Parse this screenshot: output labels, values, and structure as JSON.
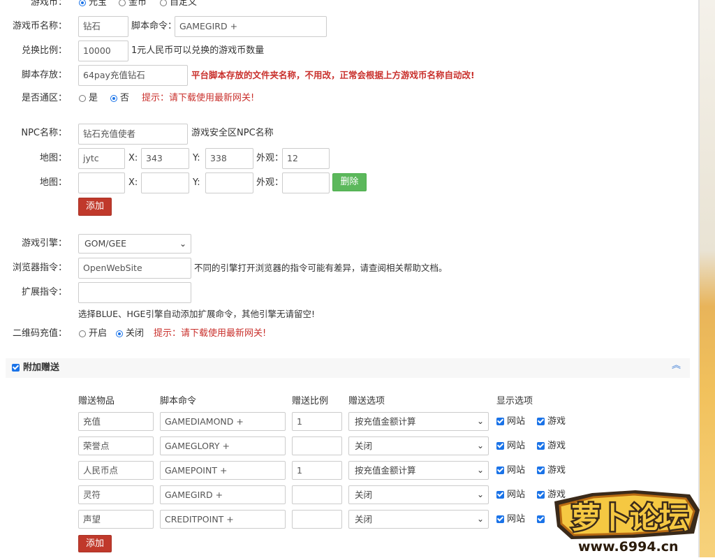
{
  "currency": {
    "label": "游戏币：",
    "options": [
      "元宝",
      "金币",
      "自定义"
    ],
    "selected": "元宝",
    "name_label": "游戏币名称：",
    "name_value": "钻石",
    "script_label": "脚本命令：",
    "script_value": "GAMEGIRD +",
    "ratio_label": "兑换比例：",
    "ratio_value": "10000",
    "ratio_hint": "1元人民币可以兑换的游戏币数量",
    "folder_label": "脚本存放：",
    "folder_value": "64pay充值钻石",
    "folder_hint": "平台脚本存放的文件夹名称，不用改，正常会根据上方游戏币名称自动改!",
    "allzone_label": "是否通区：",
    "allzone_options": [
      "是",
      "否"
    ],
    "allzone_selected": "否",
    "allzone_tip": "提示：请下载使用最新网关!"
  },
  "npc": {
    "label": "NPC名称：",
    "value": "钻石充值使者",
    "hint": "游戏安全区NPC名称",
    "map_label": "地图：",
    "x_label": "X:",
    "y_label": "Y:",
    "look_label": "外观：",
    "rows": [
      {
        "map": "jytc",
        "x": "343",
        "y": "338",
        "look": "12"
      },
      {
        "map": "",
        "x": "",
        "y": "",
        "look": ""
      }
    ],
    "delete_label": "删除",
    "add_label": "添加"
  },
  "engine": {
    "label": "游戏引擎：",
    "value": "GOM/GEE",
    "browser_label": "浏览器指令：",
    "browser_value": "OpenWebSite",
    "browser_hint": "不同的引擎打开浏览器的指令可能有差异，请查阅相关帮助文档。",
    "ext_label": "扩展指令：",
    "ext_value": "",
    "ext_hint": "选择BLUE、HGE引擎自动添加扩展命令，其他引擎无请留空!",
    "qr_label": "二维码充值：",
    "qr_options": [
      "开启",
      "关闭"
    ],
    "qr_selected": "关闭",
    "qr_tip": "提示：请下载使用最新网关!"
  },
  "bonus": {
    "title": "附加赠送",
    "headers": [
      "赠送物品",
      "脚本命令",
      "赠送比例",
      "赠送选项",
      "显示选项"
    ],
    "show_site": "网站",
    "show_game": "游戏",
    "rows": [
      {
        "item": "充值",
        "cmd": "GAMEDIAMOND +",
        "ratio": "1",
        "option": "按充值金额计算"
      },
      {
        "item": "荣誉点",
        "cmd": "GAMEGLORY +",
        "ratio": "",
        "option": "关闭"
      },
      {
        "item": "人民币点",
        "cmd": "GAMEPOINT +",
        "ratio": "1",
        "option": "按充值金额计算"
      },
      {
        "item": "灵符",
        "cmd": "GAMEGIRD +",
        "ratio": "",
        "option": "关闭"
      },
      {
        "item": "声望",
        "cmd": "CREDITPOINT +",
        "ratio": "",
        "option": "关闭"
      }
    ],
    "add_label": "添加"
  },
  "watermark": {
    "text": "萝卜论坛",
    "url": "www.6994.cn"
  },
  "colors": {
    "accent": "#1a73e8",
    "danger": "#c0392b",
    "success": "#5cb85c",
    "tip": "#c9302c"
  }
}
